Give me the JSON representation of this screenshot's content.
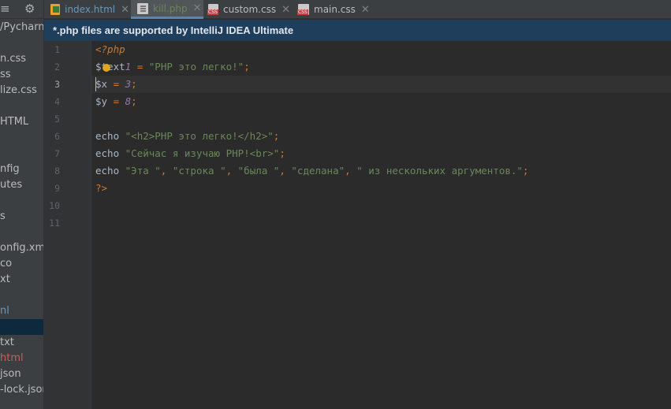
{
  "sidebar": {
    "path_fragment": "/Pycharm",
    "items": [
      {
        "label": "n.css",
        "color": "#bbbbbb"
      },
      {
        "label": "ss",
        "color": "#bbbbbb"
      },
      {
        "label": "lize.css",
        "color": "#bbbbbb"
      },
      {
        "label": "HTML",
        "color": "#bbbbbb"
      },
      {
        "label": "nfig",
        "color": "#bbbbbb"
      },
      {
        "label": "utes",
        "color": "#bbbbbb"
      },
      {
        "label": "s",
        "color": "#bbbbbb"
      },
      {
        "label": "onfig.xml",
        "color": "#bbbbbb"
      },
      {
        "label": "co",
        "color": "#bbbbbb"
      },
      {
        "label": "xt",
        "color": "#bbbbbb"
      },
      {
        "label": "nl",
        "color": "#6897bb"
      },
      {
        "label": "",
        "color": "#bbbbbb"
      },
      {
        "label": "txt",
        "color": "#bbbbbb"
      },
      {
        "label": "html",
        "color": "#cc5a5a"
      },
      {
        "label": "json",
        "color": "#bbbbbb"
      },
      {
        "label": "-lock.json",
        "color": "#bbbbbb"
      }
    ]
  },
  "tabs": [
    {
      "label": "index.html",
      "icon": "html-file-icon",
      "active": false,
      "color": "#6897bb"
    },
    {
      "label": "kill.php",
      "icon": "php-file-icon",
      "active": true,
      "color": "#6a8759"
    },
    {
      "label": "custom.css",
      "icon": "css-file-icon",
      "active": false,
      "color": "#bbbbbb"
    },
    {
      "label": "main.css",
      "icon": "css-file-icon",
      "active": false,
      "color": "#bbbbbb"
    }
  ],
  "banner": {
    "text": "*.php files are supported by IntelliJ IDEA Ultimate"
  },
  "editor": {
    "line_numbers": [
      "1",
      "2",
      "3",
      "4",
      "5",
      "6",
      "7",
      "8",
      "9",
      "10",
      "11"
    ],
    "current_line": 3,
    "lines": [
      "<?php",
      "$text1 = \"PHP это легко!\";",
      "$x = 3;",
      "$y = 8;",
      "",
      "echo \"<h2>PHP это легко!</h2>\";",
      "echo \"Сейчас я изучаю PHP!<br>\";",
      "echo \"Эта \", \"строка \", \"была \", \"сделана\", \" из нескольких аргументов.\";",
      "?>",
      "",
      ""
    ]
  },
  "colors": {
    "keyword": "#cc7832",
    "string": "#6a8759",
    "number": "#9876aa",
    "text": "#a9b7c6",
    "banner_bg": "#1f3e5c"
  }
}
